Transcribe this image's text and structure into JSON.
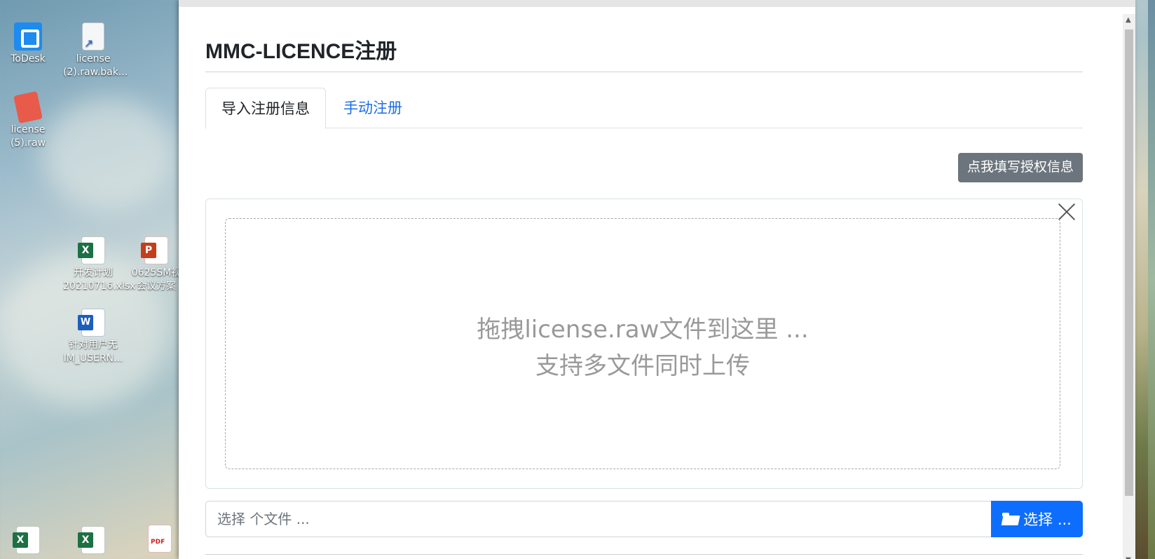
{
  "desktop": {
    "icons": [
      {
        "label": "ToDesk",
        "kind": "todesk"
      },
      {
        "label": "license (2).raw.bak...",
        "kind": "file"
      },
      {
        "label": "license (5).raw",
        "kind": "note"
      },
      {
        "label": "开发计划 20210716.xlsx",
        "kind": "xls"
      },
      {
        "label": "0625SM视 会议方案",
        "kind": "ppt"
      },
      {
        "label": "针对用户无 IM_USERN...",
        "kind": "doc"
      }
    ]
  },
  "modal": {
    "title": "MMC-LICENCE注册",
    "tabs": [
      {
        "label": "导入注册信息",
        "active": true
      },
      {
        "label": "手动注册",
        "active": false
      }
    ],
    "auth_button": "点我填写授权信息",
    "drop_zone": {
      "line1": "拖拽license.raw文件到这里 ...",
      "line2": "支持多文件同时上传"
    },
    "file_input": {
      "placeholder": "选择 个文件 ..."
    },
    "choose_button": "选择 ..."
  },
  "colors": {
    "primary": "#0d6efd",
    "secondary": "#6c757d",
    "link": "#1d6ee6"
  }
}
